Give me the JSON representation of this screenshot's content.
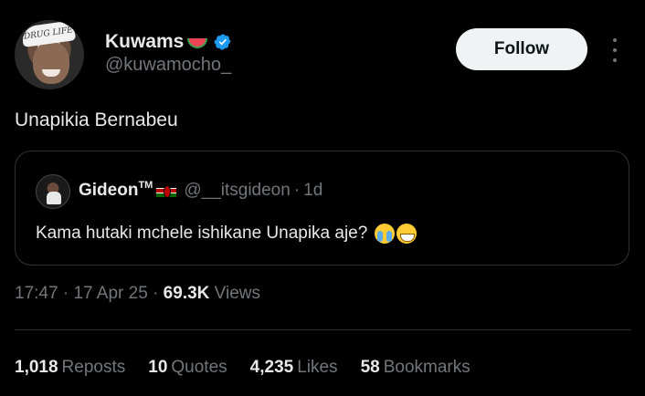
{
  "author": {
    "display_name": "Kuwams",
    "handle": "@kuwamocho_",
    "avatar_cap_text": "DRUG LIFE"
  },
  "follow_label": "Follow",
  "tweet_text": "Unapikia Bernabeu",
  "quote": {
    "name": "Gideon",
    "tm": "TM",
    "handle": "@__itsgideon",
    "dot": "·",
    "time": "1d",
    "text": "Kama hutaki mchele ishikane Unapika aje?"
  },
  "meta": {
    "time": "17:47",
    "sep": "·",
    "date": "17 Apr 25",
    "views_count": "69.3K",
    "views_label": "Views"
  },
  "stats": [
    {
      "num": "1,018",
      "label": "Reposts"
    },
    {
      "num": "10",
      "label": "Quotes"
    },
    {
      "num": "4,235",
      "label": "Likes"
    },
    {
      "num": "58",
      "label": "Bookmarks"
    }
  ],
  "colors": {
    "background": "#000000",
    "text_primary": "#e7e9ea",
    "text_secondary": "#71767b",
    "verified": "#1d9bf0",
    "border": "#2f3336"
  }
}
